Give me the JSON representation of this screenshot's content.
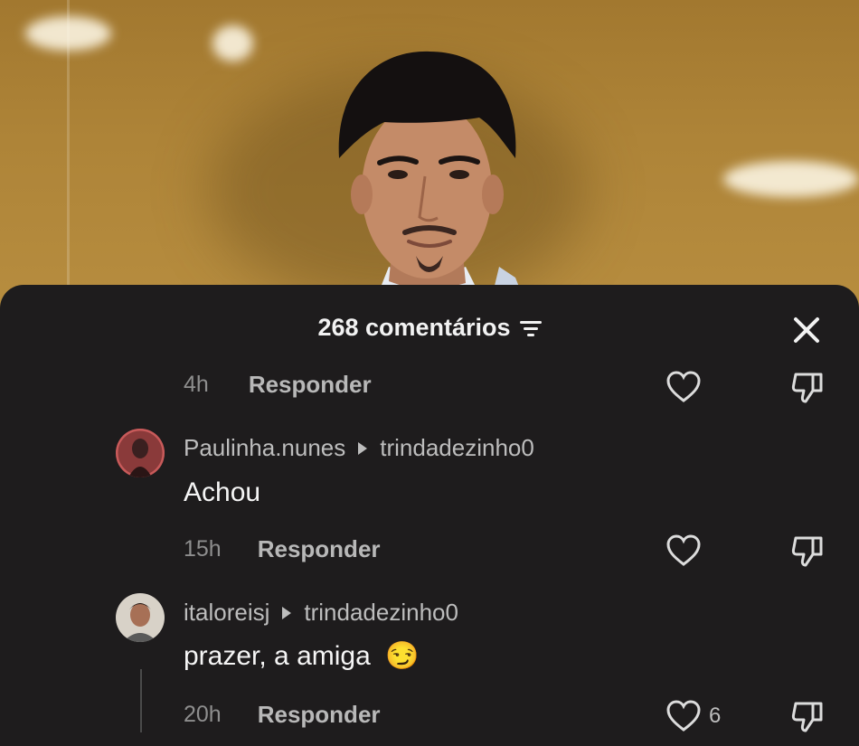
{
  "header": {
    "comment_count": "268 comentários",
    "filter_icon": "filter-icon",
    "close_icon": "close-icon"
  },
  "comments": [
    {
      "time": "4h",
      "reply_label": "Responder"
    },
    {
      "username": "Paulinha.nunes",
      "reply_to": "trindadezinho0",
      "text": "Achou",
      "time": "15h",
      "reply_label": "Responder"
    },
    {
      "username": "italoreisj",
      "reply_to": "trindadezinho0",
      "text": "prazer, a amiga",
      "emoji": "😏",
      "time": "20h",
      "reply_label": "Responder",
      "likes": "6"
    }
  ],
  "colors": {
    "sheet_bg": "#1e1c1d",
    "text_primary": "#f5f5f5",
    "text_secondary": "#bdbdbd",
    "photo_bg": "#b08638"
  }
}
